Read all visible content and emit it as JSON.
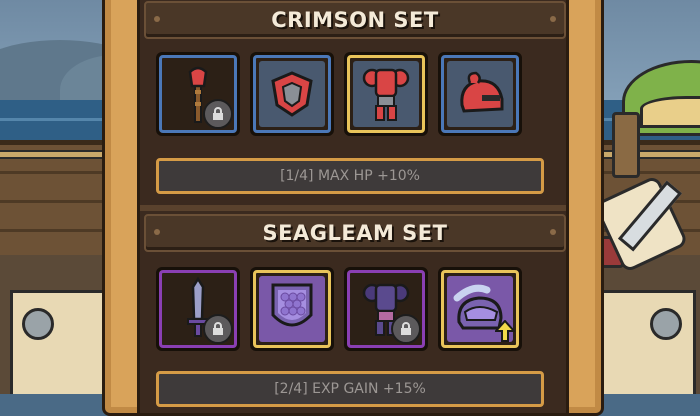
{
  "sets": [
    {
      "title": "CRIMSON SET",
      "bonus": "[1/4] MAX HP +10%",
      "items": [
        {
          "icon": "mace-icon",
          "locked": true,
          "frame": "blue",
          "equipped": false
        },
        {
          "icon": "shield-icon",
          "locked": false,
          "frame": "blue",
          "equipped": false
        },
        {
          "icon": "armor-icon",
          "locked": false,
          "frame": "gold",
          "equipped": true
        },
        {
          "icon": "helmet-icon",
          "locked": false,
          "frame": "blue",
          "equipped": false
        }
      ]
    },
    {
      "title": "SEAGLEAM SET",
      "bonus": "[2/4] EXP GAIN +15%",
      "items": [
        {
          "icon": "sword-icon",
          "locked": true,
          "frame": "purple",
          "equipped": false
        },
        {
          "icon": "shield-icon",
          "locked": false,
          "frame": "gold",
          "equipped": true
        },
        {
          "icon": "armor-icon",
          "locked": true,
          "frame": "purple",
          "equipped": false
        },
        {
          "icon": "helmet-icon",
          "locked": false,
          "frame": "gold",
          "equipped": true,
          "upgrade": true
        }
      ]
    }
  ],
  "colors": {
    "crimson": "#d94545",
    "seagleam_blade": "#9c9fc9",
    "seagleam_armor": "#7a63b0",
    "blue_frame": "#4b78b8",
    "gold_frame": "#e9c45a",
    "purple_frame": "#8a3fb3",
    "bonus_border": "#d59b46"
  }
}
